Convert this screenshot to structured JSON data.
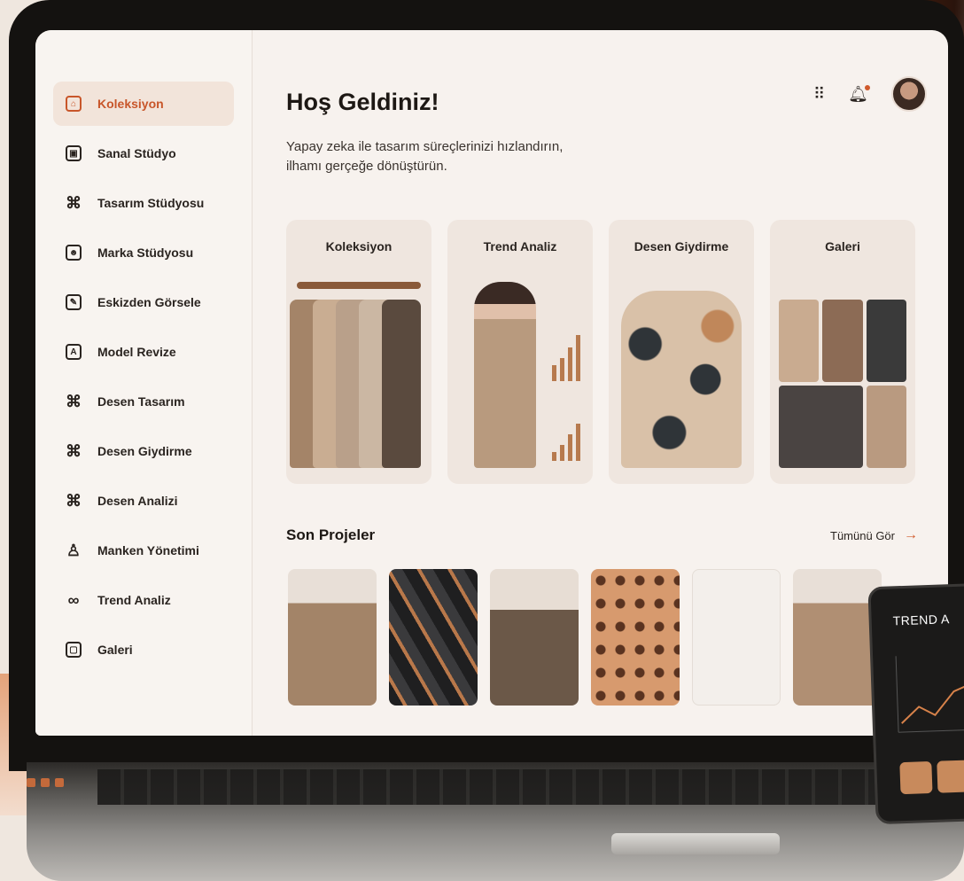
{
  "sidebar": {
    "items": [
      {
        "label": "Koleksiyon",
        "icon": "home-icon"
      },
      {
        "label": "Sanal Stüdyo",
        "icon": "studio-icon"
      },
      {
        "label": "Tasarım Stüdyosu",
        "icon": "knot-icon"
      },
      {
        "label": "Marka Stüdyosu",
        "icon": "brand-icon"
      },
      {
        "label": "Eskizden Görsele",
        "icon": "sketch-icon"
      },
      {
        "label": "Model Revize",
        "icon": "model-icon"
      },
      {
        "label": "Desen Tasarım",
        "icon": "pattern-icon"
      },
      {
        "label": "Desen Giydirme",
        "icon": "pattern-icon"
      },
      {
        "label": "Desen Analizi",
        "icon": "pattern-icon"
      },
      {
        "label": "Manken Yönetimi",
        "icon": "mannequin-icon"
      },
      {
        "label": "Trend Analiz",
        "icon": "trend-icon"
      },
      {
        "label": "Galeri",
        "icon": "gallery-icon"
      }
    ]
  },
  "header": {
    "title": "Hoş Geldiniz!",
    "subtitle": "Yapay zeka ile tasarım süreçlerinizi hızlandırın, ilhamı gerçeğe dönüştürün.",
    "icons": [
      "apps-grid-icon",
      "bell-icon",
      "user-avatar"
    ]
  },
  "cards": [
    {
      "label": "Koleksiyon"
    },
    {
      "label": "Trend Analiz"
    },
    {
      "label": "Desen Giydirme"
    },
    {
      "label": "Galeri"
    }
  ],
  "recent": {
    "title": "Son Projeler",
    "see_all": "Tümünü Gör"
  },
  "tablet": {
    "title": "TREND A"
  },
  "colors": {
    "accent": "#d05a2c",
    "active_bg": "#f2e4da",
    "screen_bg": "#f7f2ee",
    "card_bg": "#efe6df"
  }
}
